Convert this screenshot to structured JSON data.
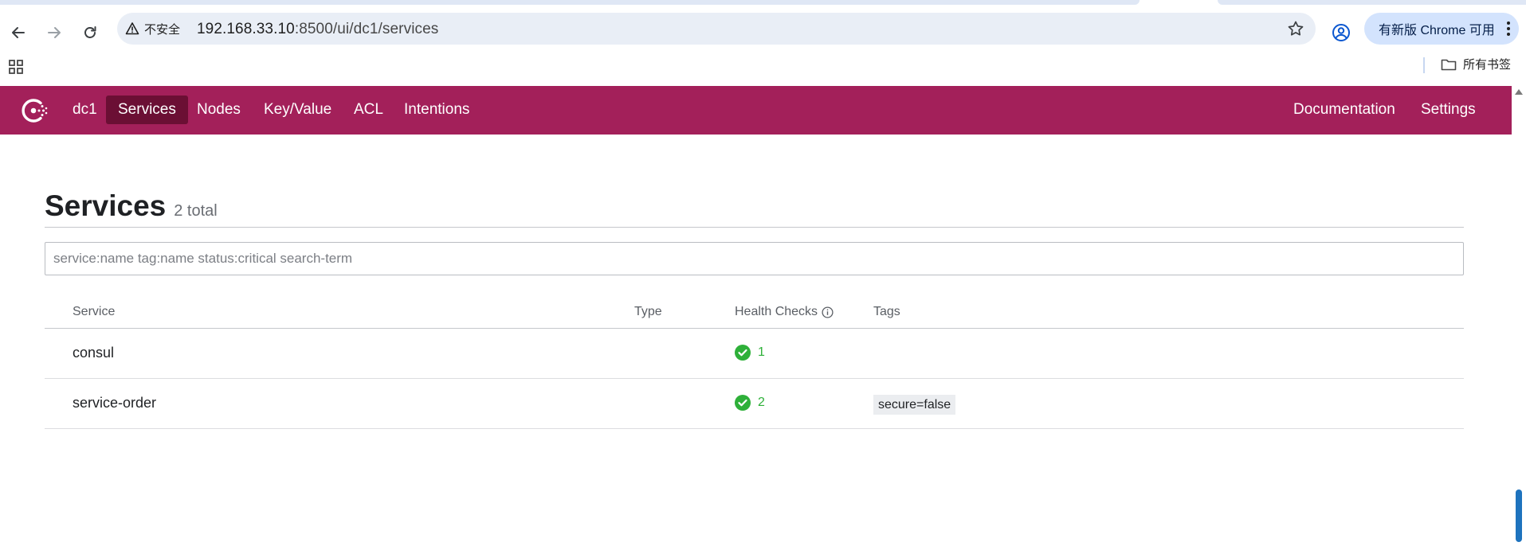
{
  "browser": {
    "security_label": "不安全",
    "url_host": "192.168.33.10",
    "url_rest": ":8500/ui/dc1/services",
    "update_button": "有新版 Chrome 可用",
    "bookmarks_all": "所有书签"
  },
  "header": {
    "datacenter": "dc1",
    "nav": {
      "services": "Services",
      "nodes": "Nodes",
      "kv": "Key/Value",
      "acl": "ACL",
      "intentions": "Intentions",
      "documentation": "Documentation",
      "settings": "Settings"
    },
    "brand_color": "#a3205a",
    "active_color": "#6b0f34"
  },
  "page": {
    "title": "Services",
    "count": "2 total",
    "search_placeholder": "service:name tag:name status:critical search-term"
  },
  "table": {
    "headers": {
      "service": "Service",
      "type": "Type",
      "health": "Health Checks",
      "tags": "Tags"
    },
    "rows": [
      {
        "name": "consul",
        "type": "",
        "health_passing": "1",
        "tags": []
      },
      {
        "name": "service-order",
        "type": "",
        "health_passing": "2",
        "tags": [
          "secure=false"
        ]
      }
    ]
  },
  "colors": {
    "passing": "#2eb039"
  }
}
